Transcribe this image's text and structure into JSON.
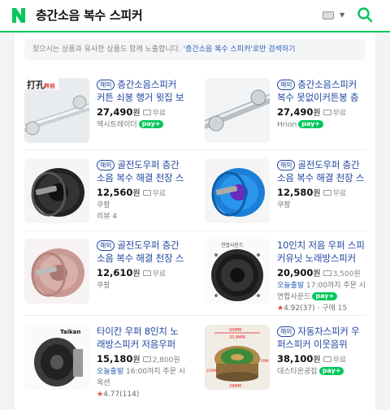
{
  "header": {
    "logo_text": "N",
    "query": "층간소음 복수 스피커"
  },
  "notice": {
    "prefix": "찾으시는 상품과 유사한 상품도 함께 노출합니다.",
    "query_link": "'층간소음 복수 스피커'로만 검색하기"
  },
  "colors": {
    "brand": "#03c75a",
    "link": "#2147a0",
    "price": "#111111"
  },
  "products": [
    {
      "badge": "해외",
      "title": "층간소음스피커 커튼 쇠봉 행거 윗집 보복 층간소음 복수",
      "price": "27,490",
      "won": "원",
      "shipping": "무료",
      "seller": "엑시트레이더",
      "npay": "pay+"
    },
    {
      "badge": "해외",
      "title": "층간소음스피커 복수 못없이커튼봉 층간 소음",
      "price": "27,490",
      "won": "원",
      "shipping": "무료",
      "seller": "Hrion",
      "npay": "pay+"
    },
    {
      "badge": "해외",
      "title": "골전도우퍼 층간소음 복수 해결 천장 스피커",
      "price": "12,560",
      "won": "원",
      "shipping": "무료",
      "seller": "쿠팡",
      "review": "리뷰 4"
    },
    {
      "badge": "해외",
      "title": "골전도우퍼 층간소음 복수 해결 천장 스피커",
      "price": "12,580",
      "won": "원",
      "shipping": "무료",
      "seller": "쿠팡"
    },
    {
      "badge": "해외",
      "title": "골전도우퍼 층간소음 복수 해결 천장 스피커",
      "price": "12,610",
      "won": "원",
      "shipping": "무료",
      "seller": "쿠팡"
    },
    {
      "title": "10인치 저음 우퍼 스피커유닛 노래방스피커",
      "price": "20,900",
      "won": "원",
      "shipping": "3,500원",
      "delivery": "오늘출발",
      "delivery_time": "17:00까지 주문 시",
      "seller": "연합사운드",
      "npay": "pay+",
      "rating": "4.92",
      "rating_count": "(37)",
      "purchase": "· 구매 15"
    },
    {
      "title": "타이칸 우퍼 8인치 노래방스피커 저음우퍼",
      "price": "15,180",
      "won": "원",
      "shipping": "2,800원",
      "delivery": "오늘출발",
      "delivery_time": "16:00까지 주문 시",
      "seller": "옥션",
      "rating": "4.77",
      "rating_count": "(114)"
    },
    {
      "badge": "해외",
      "title": "자동차스피커 우퍼스피커 이웃음위",
      "price": "38,100",
      "won": "원",
      "shipping": "무료",
      "seller": "대스타운공잡",
      "npay": "pay+"
    }
  ],
  "images": {
    "p0_logo": "打孔",
    "p0_sub": "無痕",
    "p5_label": "연합사운드",
    "p6_brand": "Taikan",
    "p7_dim_outer": "50MM",
    "p7_dim_inner": "33.8MM",
    "p7_dim_side": "7MM",
    "p7_dim_height": "22MM",
    "p7_dim_bottom": "29MM"
  }
}
